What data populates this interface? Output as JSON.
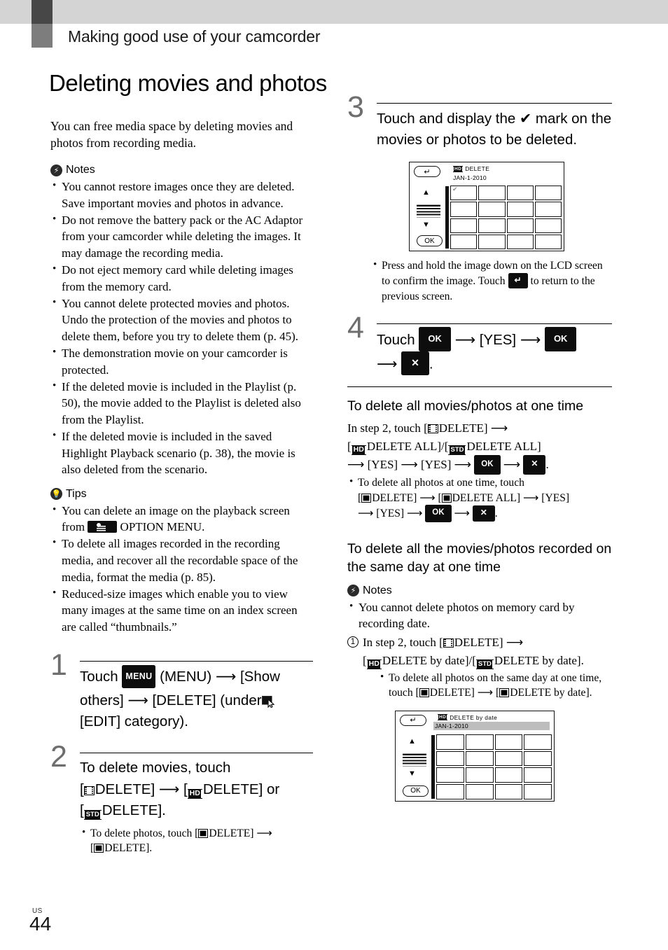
{
  "running_head": "Making good use of your camcorder",
  "page_title": "Deleting movies and photos",
  "lead": "You can free media space by deleting movies and photos from recording media.",
  "labels": {
    "notes": "Notes",
    "tips": "Tips",
    "note_icon": "lightning-bolt-icon",
    "tip_icon": "lightbulb-icon"
  },
  "notes": [
    "You cannot restore images once they are deleted. Save important movies and photos in advance.",
    "Do not remove the battery pack or the AC Adaptor from your camcorder while deleting the images. It may damage the recording media.",
    "Do not eject memory card while deleting images from the memory card.",
    "You cannot delete protected movies and photos. Undo the protection of the movies and photos to delete them, before you try to delete them (p. 45).",
    "The demonstration movie on your camcorder is protected.",
    "If the deleted movie is included in the Playlist (p. 50), the movie added to the Playlist is deleted also from the Playlist.",
    "If the deleted movie is included in the saved Highlight Playback scenario (p. 38), the movie is also deleted from the scenario."
  ],
  "tips": {
    "tip1_a": "You can delete an image on the playback screen from",
    "tip1_b": "OPTION MENU.",
    "tip2": "To delete all images recorded in the recording media, and recover all the recordable space of the media, format the media (p. 85).",
    "tip3": "Reduced-size images which enable you to view many images at the same time on an index screen are called “thumbnails.”"
  },
  "steps": {
    "step1": {
      "num": "1",
      "t1": "Touch",
      "menu_chip": "MENU",
      "t2": "(MENU)",
      "t3": "[Show others]",
      "t4": "[DELETE] (under",
      "t5": "[EDIT] category)."
    },
    "step2": {
      "num": "2",
      "t1": "To delete movies, touch",
      "t2": "[",
      "t3": "DELETE]",
      "t4": "[",
      "hd": "HD",
      "t5": "DELETE] or",
      "t6": "[",
      "std": "STD",
      "t7": "DELETE].",
      "sub_a": "To delete photos, touch [",
      "sub_b": "DELETE]",
      "sub_c": "[",
      "sub_d": "DELETE]."
    },
    "step3": {
      "num": "3",
      "t1": "Touch and display the",
      "check": "✔",
      "t2": "mark on the movies or photos to be deleted.",
      "sub_a": "Press and hold the image down on the LCD screen to confirm the image. Touch",
      "sub_b": "to return to the previous screen."
    },
    "step4": {
      "num": "4",
      "t1": "Touch",
      "ok1": "OK",
      "yes": "[YES]",
      "ok2": "OK",
      "x": "✕",
      "period": "."
    }
  },
  "section_all": {
    "heading": "To delete all movies/photos at one time",
    "l1_a": "In step 2, touch [",
    "l1_b": "DELETE]",
    "l2_a": "[",
    "l2_hd": "HD",
    "l2_b": "DELETE ALL]/[",
    "l2_std": "STD",
    "l2_c": "DELETE ALL]",
    "l3_yes1": "[YES]",
    "l3_yes2": "[YES]",
    "l3_ok": "OK",
    "l3_x": "✕",
    "bullet_a": "To delete all photos at one time, touch",
    "bullet_b": "[",
    "bullet_c": "DELETE]",
    "bullet_d": "[",
    "bullet_e": "DELETE ALL]",
    "bullet_yes1": "[YES]",
    "bullet_yes2": "[YES]",
    "bullet_ok": "OK",
    "bullet_x": "✕"
  },
  "section_day": {
    "heading": "To delete all the movies/photos recorded on the same day at one time",
    "notes": [
      "You cannot delete photos on memory card by recording date."
    ],
    "item1": {
      "num": "1",
      "a": "In step 2, touch [",
      "b": "DELETE]",
      "c": "[",
      "hd": "HD",
      "d": "DELETE by date]/[",
      "std": "STD",
      "e": "DELETE by date].",
      "sub_a": "To delete all photos on the same day at one time, touch [",
      "sub_b": "DELETE]",
      "sub_c": "[",
      "sub_d": "DELETE by date]."
    }
  },
  "figures": {
    "fig1": {
      "back_icon": "back-arrow-icon",
      "format": "HD",
      "title": "DELETE",
      "date": "JAN-1-2010",
      "up_icon": "▲",
      "down_icon": "▼",
      "ok": "OK",
      "checked_cell_mark": "✔"
    },
    "fig2": {
      "back_icon": "back-arrow-icon",
      "format": "HD",
      "title": "DELETE by date",
      "date": "JAN-1-2010",
      "up_icon": "▲",
      "down_icon": "▼",
      "ok": "OK"
    }
  },
  "folio": {
    "region": "US",
    "page": "44"
  },
  "colors": {
    "band": "#d4d4d4",
    "tab_dark": "#474747",
    "tab_mid": "#7d7d7d",
    "step_number": "#6e6e6e",
    "chip_bg": "#0d0d0d"
  }
}
